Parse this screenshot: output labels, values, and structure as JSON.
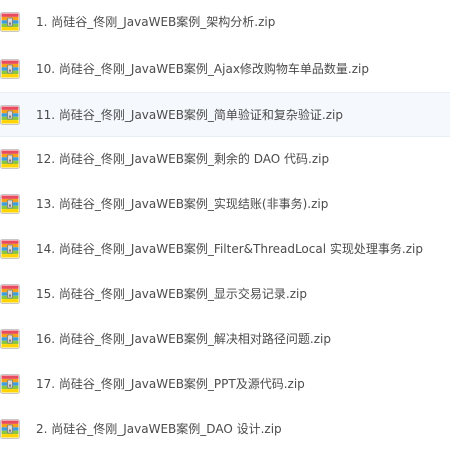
{
  "file_list": {
    "icon": "zip-archive-icon",
    "icon_colors": [
      "#e84a5f",
      "#f7a11a",
      "#3b9de0",
      "#8cc63f",
      "#ffd400"
    ],
    "selected_index": 2,
    "items": [
      {
        "name": "1. 尚硅谷_佟刚_JavaWEB案例_架构分析.zip"
      },
      {
        "name": "10. 尚硅谷_佟刚_JavaWEB案例_Ajax修改购物车单品数量.zip"
      },
      {
        "name": "11. 尚硅谷_佟刚_JavaWEB案例_简单验证和复杂验证.zip"
      },
      {
        "name": "12. 尚硅谷_佟刚_JavaWEB案例_剩余的 DAO 代码.zip"
      },
      {
        "name": "13. 尚硅谷_佟刚_JavaWEB案例_实现结账(非事务).zip"
      },
      {
        "name": "14. 尚硅谷_佟刚_JavaWEB案例_Filter&ThreadLocal 实现处理事务.zip"
      },
      {
        "name": "15. 尚硅谷_佟刚_JavaWEB案例_显示交易记录.zip"
      },
      {
        "name": "16. 尚硅谷_佟刚_JavaWEB案例_解决相对路径问题.zip"
      },
      {
        "name": "17. 尚硅谷_佟刚_JavaWEB案例_PPT及源代码.zip"
      },
      {
        "name": "2. 尚硅谷_佟刚_JavaWEB案例_DAO 设计.zip"
      }
    ]
  }
}
